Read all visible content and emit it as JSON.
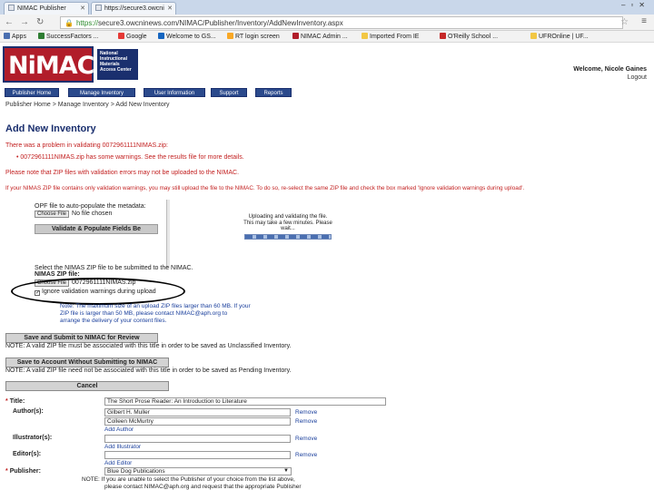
{
  "browser": {
    "tabs": [
      {
        "label": "NIMAC Publisher"
      },
      {
        "label": "https://secure3.owcni"
      }
    ],
    "url_host": "secure3.owcninews.com",
    "url_prefix": "https://",
    "url_path": "/NIMAC/Publisher/Inventory/AddNewInventory.aspx",
    "bookmarks": [
      {
        "label": "Apps",
        "color": "#4a6fb0"
      },
      {
        "label": "SuccessFactors ...",
        "color": "#2e7d32"
      },
      {
        "label": "Google",
        "color": "#e53935"
      },
      {
        "label": "Welcome to GS...",
        "color": "#1565c0"
      },
      {
        "label": "RT login screen",
        "color": "#f9a825"
      },
      {
        "label": "NIMAC Admin ...",
        "color": "#b11d2a"
      },
      {
        "label": "Imported From IE",
        "color": "#f2c744"
      },
      {
        "label": "O'Reilly School ...",
        "color": "#c62828"
      },
      {
        "label": "UFROnline | UF...",
        "color": "#f2c744"
      }
    ]
  },
  "header": {
    "logo": "NiMAC",
    "logo_side": "National Instructional Materials Access Center",
    "welcome": "Welcome, Nicole Gaines",
    "logout": "Logout"
  },
  "nav": {
    "tabs": [
      "Publisher Home",
      "Manage Inventory",
      "User Information",
      "Support",
      "Reports"
    ]
  },
  "breadcrumb": "Publisher Home > Manage Inventory > Add New Inventory",
  "page": {
    "title": "Add New Inventory",
    "errors": [
      "There was a problem in validating 0072961111NIMAS.zip:",
      "• 0072961111NIMAS.zip has some warnings. See the results file for more details.",
      "Please note that ZIP files with validation errors may not be uploaded to the NIMAC.",
      "If your NIMAS ZIP file contains only validation warnings, you may still upload the file to the NIMAC. To do so, re-select the same ZIP file and check the box marked 'Ignore validation warnings during upload'."
    ]
  },
  "upload": {
    "opf_label": "OPF file to auto-populate the metadata:",
    "choose_file": "Choose File",
    "no_file": "No file chosen",
    "validate_button": "Validate & Populate Fields Be",
    "progress_title": "Uploading and validating the file.",
    "progress_sub": "This may take a few minutes. Please wait...",
    "select_text": "Select the NIMAS ZIP file to be submitted to the NIMAC.",
    "zip_label": "NIMAS ZIP file:",
    "zip_value": "0072961111NIMAS.zip",
    "ignore_label": "Ignore validation warnings during upload",
    "note_lines": [
      "Note: The maximum size of an upload ZIP files larger than 60 MB. If your",
      "ZIP file is larger than 50 MB, please contact NIMAC@aph.org to",
      "arrange the delivery of your content files."
    ]
  },
  "actions": {
    "submit_button": "Save and Submit to NIMAC for Review",
    "submit_note": "NOTE: A valid ZIP file must be associated with this title in order to be saved as Unclassified Inventory.",
    "save_button": "Save to Account Without Submitting to NIMAC",
    "save_note": "NOTE: A valid ZIP file need not be associated with this title in order to be saved as Pending Inventory.",
    "cancel_button": "Cancel"
  },
  "form": {
    "title_label": "Title:",
    "title_value": "The Short Prose Reader: An Introduction to Literature",
    "authors_label": "Author(s):",
    "authors": [
      "Gilbert H. Muller",
      "Colleen McMurtry"
    ],
    "remove_label": "Remove",
    "add_author": "Add Author",
    "illustrators_label": "Illustrator(s):",
    "add_illustrator": "Add Illustrator",
    "editors_label": "Editor(s):",
    "add_editor": "Add Editor",
    "publisher_label": "Publisher:",
    "publisher_value": "Blue Dog Publications",
    "publisher_note": [
      "NOTE: If you are unable to select the Publisher of your choice from the list above,",
      "please contact NIMAC@aph.org and request that the appropriate Publisher"
    ]
  }
}
